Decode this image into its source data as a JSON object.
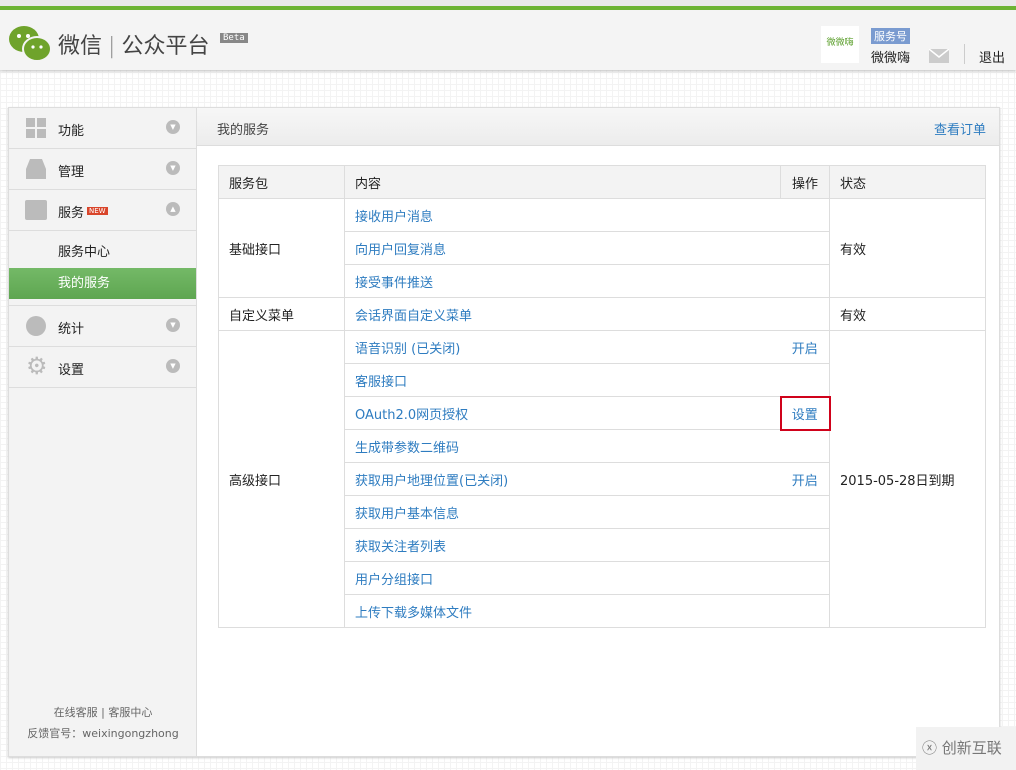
{
  "header": {
    "brand_primary": "微信",
    "brand_secondary": "公众平台",
    "beta": "Beta",
    "account_logo_text": "微微嗨",
    "account_type": "服务号",
    "account_name": "微微嗨",
    "logout": "退出"
  },
  "sidebar": {
    "items": [
      {
        "label": "功能",
        "icon": "grid-icon"
      },
      {
        "label": "管理",
        "icon": "inbox-icon"
      },
      {
        "label": "服务",
        "icon": "printer-icon",
        "badge": "NEW",
        "sub": [
          {
            "label": "服务中心"
          },
          {
            "label": "我的服务",
            "active": true
          }
        ]
      },
      {
        "label": "统计",
        "icon": "pie-chart-icon"
      },
      {
        "label": "设置",
        "icon": "gear-icon"
      }
    ],
    "footer": {
      "link1": "在线客服",
      "sep": "|",
      "link2": "客服中心",
      "feedback": "反馈官号：weixingongzhong"
    }
  },
  "main": {
    "title": "我的服务",
    "orders_link": "查看订单",
    "table": {
      "headers": [
        "服务包",
        "内容",
        "操作",
        "状态"
      ],
      "groups": [
        {
          "name": "基础接口",
          "status": "有效",
          "rows": [
            {
              "content": "接收用户消息",
              "action": ""
            },
            {
              "content": "向用户回复消息",
              "action": ""
            },
            {
              "content": "接受事件推送",
              "action": ""
            }
          ]
        },
        {
          "name": "自定义菜单",
          "status": "有效",
          "rows": [
            {
              "content": "会话界面自定义菜单",
              "action": ""
            }
          ]
        },
        {
          "name": "高级接口",
          "status": "2015-05-28日到期",
          "rows": [
            {
              "content": "语音识别 (已关闭)",
              "action": "开启"
            },
            {
              "content": "客服接口",
              "action": ""
            },
            {
              "content": "OAuth2.0网页授权",
              "action": "设置",
              "highlighted": true
            },
            {
              "content": "生成带参数二维码",
              "action": ""
            },
            {
              "content": "获取用户地理位置(已关闭)",
              "action": "开启"
            },
            {
              "content": "获取用户基本信息",
              "action": ""
            },
            {
              "content": "获取关注者列表",
              "action": ""
            },
            {
              "content": "用户分组接口",
              "action": ""
            },
            {
              "content": "上传下载多媒体文件",
              "action": ""
            }
          ]
        }
      ]
    }
  },
  "watermark": "创新互联",
  "colors": {
    "accent_green": "#6cb333",
    "link_blue": "#2e7cc0",
    "highlight_red": "#d0021b"
  }
}
